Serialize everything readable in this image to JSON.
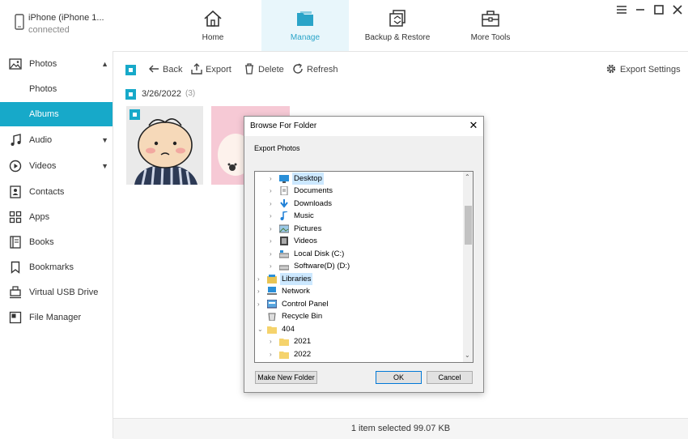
{
  "device": {
    "name": "iPhone (iPhone 1...",
    "status": "connected"
  },
  "nav": [
    {
      "label": "Home",
      "icon": "home-icon"
    },
    {
      "label": "Manage",
      "icon": "folder-icon"
    },
    {
      "label": "Backup & Restore",
      "icon": "backup-icon"
    },
    {
      "label": "More Tools",
      "icon": "toolbox-icon"
    }
  ],
  "window_controls": [
    "menu-icon",
    "minimize-icon",
    "maximize-icon",
    "close-icon"
  ],
  "sidebar": {
    "items": [
      {
        "label": "Photos",
        "icon": "photo-icon",
        "expanded": true
      },
      {
        "label": "Photos",
        "icon": ""
      },
      {
        "label": "Albums",
        "icon": ""
      },
      {
        "label": "Audio",
        "icon": "music-icon"
      },
      {
        "label": "Videos",
        "icon": "play-icon"
      },
      {
        "label": "Contacts",
        "icon": "contacts-icon"
      },
      {
        "label": "Apps",
        "icon": "apps-icon"
      },
      {
        "label": "Books",
        "icon": "book-icon"
      },
      {
        "label": "Bookmarks",
        "icon": "bookmark-icon"
      },
      {
        "label": "Virtual USB Drive",
        "icon": "usb-icon"
      },
      {
        "label": "File Manager",
        "icon": "file-manager-icon"
      }
    ]
  },
  "toolbar": {
    "back": "Back",
    "export": "Export",
    "delete": "Delete",
    "refresh": "Refresh",
    "export_settings": "Export Settings"
  },
  "group": {
    "date": "3/26/2022",
    "count": "(3)"
  },
  "status": "1 item selected 99.07 KB",
  "colors": {
    "accent": "#17a9c9",
    "selection": "#cce8ff"
  },
  "dialog": {
    "title": "Browse For Folder",
    "subtitle": "Export Photos",
    "tree": [
      {
        "label": "Desktop",
        "icon": "desktop-icon",
        "selected": true
      },
      {
        "label": "Documents",
        "icon": "documents-icon"
      },
      {
        "label": "Downloads",
        "icon": "download-icon"
      },
      {
        "label": "Music",
        "icon": "music-icon"
      },
      {
        "label": "Pictures",
        "icon": "pictures-icon"
      },
      {
        "label": "Videos",
        "icon": "video-icon"
      },
      {
        "label": "Local Disk (C:)",
        "icon": "disk-icon"
      },
      {
        "label": "Software(D) (D:)",
        "icon": "disk-icon"
      },
      {
        "label": "Libraries",
        "icon": "libraries-icon"
      },
      {
        "label": "Network",
        "icon": "network-icon"
      },
      {
        "label": "Control Panel",
        "icon": "control-panel-icon"
      },
      {
        "label": "Recycle Bin",
        "icon": "recycle-bin-icon"
      },
      {
        "label": "404",
        "icon": "folder-icon",
        "expanded": true
      },
      {
        "label": "2021",
        "icon": "folder-icon"
      },
      {
        "label": "2022",
        "icon": "folder-icon"
      }
    ],
    "make_new_folder": "Make New Folder",
    "ok": "OK",
    "cancel": "Cancel"
  }
}
